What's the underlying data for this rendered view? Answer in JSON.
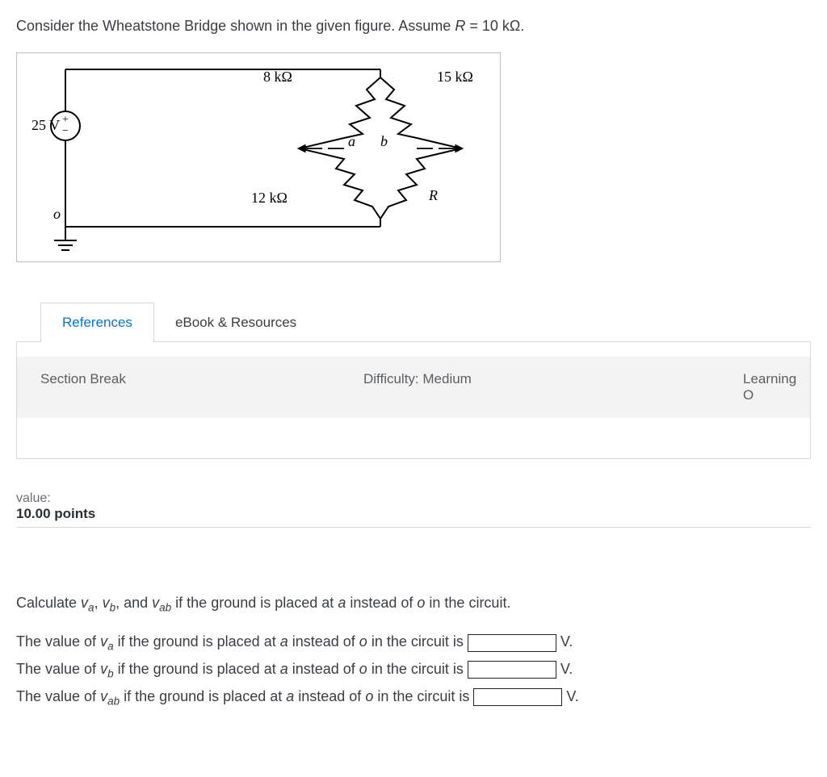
{
  "prompt": {
    "preText": "Consider the Wheatstone Bridge shown in the given figure. Assume ",
    "varR": "R",
    "eq": " = 10 kΩ."
  },
  "figure": {
    "source": "25 V",
    "r1": "8 kΩ",
    "r2": "15 kΩ",
    "r3": "12 kΩ",
    "r4": "R",
    "node_a": "a",
    "node_b": "b",
    "node_o": "o"
  },
  "tabs": {
    "references": "References",
    "ebook": "eBook & Resources"
  },
  "panel": {
    "section": "Section Break",
    "difficulty": "Difficulty: Medium",
    "learning": "Learning O"
  },
  "value": {
    "label": "value:",
    "points": "10.00 points"
  },
  "question": {
    "calc_pre": "Calculate ",
    "va": "v",
    "va_sub": "a",
    "comma1": ", ",
    "vb": "v",
    "vb_sub": "b",
    "comma2": ", and ",
    "vab": "v",
    "vab_sub": "ab",
    "calc_post": " if the ground is placed at ",
    "a_node": "a",
    "instead": " instead of ",
    "o_node": "o",
    "tail": " in the circuit."
  },
  "answers": {
    "line1_pre": "The value of ",
    "line1_var": "v",
    "line1_sub": "a",
    "cond": " if the ground is placed at ",
    "a": "a",
    "instead": " instead of ",
    "o": "o",
    "inckt": " in the circuit is ",
    "unit": "V.",
    "line2_var": "v",
    "line2_sub": "b",
    "line3_var": "v",
    "line3_sub": "ab"
  }
}
